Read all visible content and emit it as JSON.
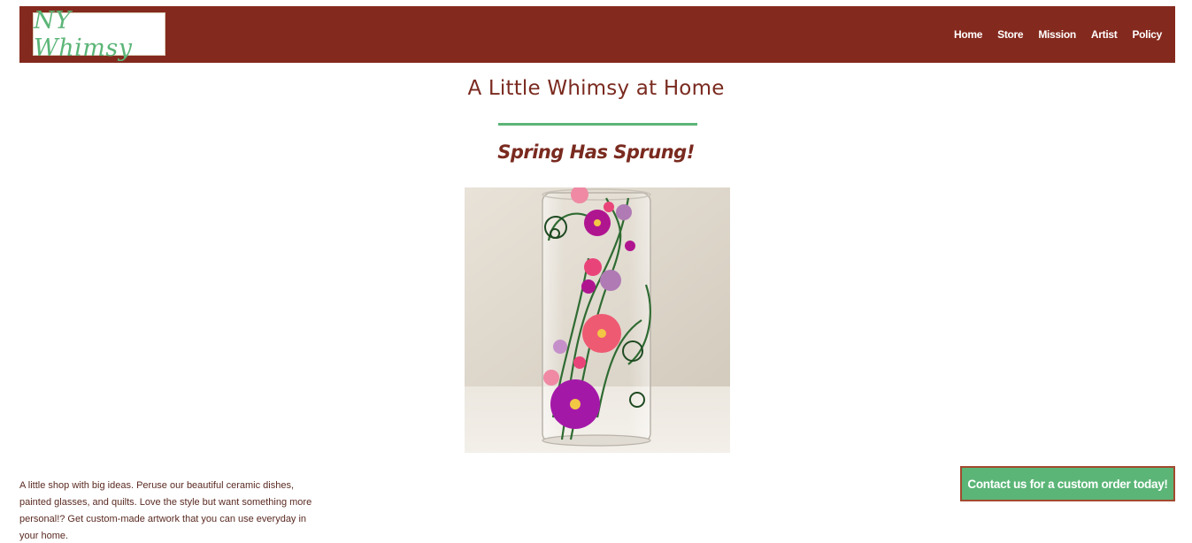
{
  "header": {
    "logo_text": "NY Whimsy",
    "nav": [
      {
        "label": "Home"
      },
      {
        "label": "Store"
      },
      {
        "label": "Mission"
      },
      {
        "label": "Artist"
      },
      {
        "label": "Policy"
      }
    ]
  },
  "main": {
    "title": "A Little Whimsy at Home",
    "subtitle": "Spring Has Sprung!"
  },
  "footer": {
    "description": "A little shop with big ideas. Peruse our beautiful ceramic dishes, painted glasses, and quilts. Love the style but want something more personal!? Get custom-made artwork that you can use everyday in your home.",
    "contact_button": "Contact us for a custom order today!"
  },
  "colors": {
    "header_bg": "#84291d",
    "accent_green": "#5bb577",
    "title_text": "#7a2a1f"
  }
}
